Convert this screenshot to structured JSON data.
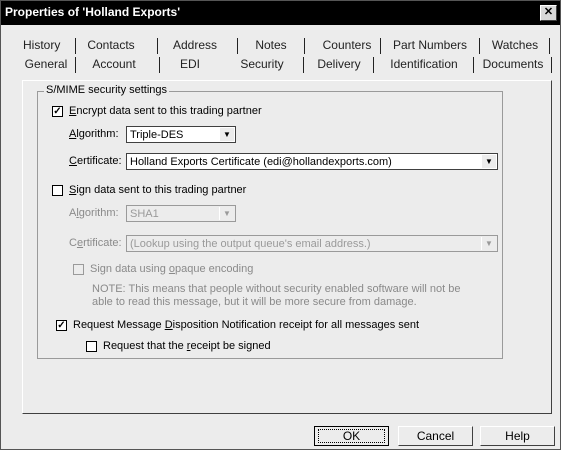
{
  "window": {
    "title": "Properties of 'Holland Exports'"
  },
  "tabs": {
    "row1": [
      "History",
      "Contacts",
      "Address",
      "Notes",
      "Counters",
      "Part Numbers",
      "Watches"
    ],
    "row2": [
      "General",
      "Account",
      "EDI",
      "Security",
      "Delivery",
      "Identification",
      "Documents"
    ],
    "selected": "Security"
  },
  "group": {
    "label": "S/MIME security settings"
  },
  "encrypt": {
    "checked": true,
    "label_pre": "",
    "label_acc": "E",
    "label_post": "ncrypt data sent to this trading partner",
    "algorithm_label_acc": "A",
    "algorithm_label_post": "lgorithm:",
    "algorithm_value": "Triple-DES",
    "certificate_label_acc": "C",
    "certificate_label_post": "ertificate:",
    "certificate_value": "Holland Exports Certificate (edi@hollandexports.com)"
  },
  "sign": {
    "checked": false,
    "label_acc": "S",
    "label_post": "ign data sent to this trading partner",
    "algorithm_label_acc": "l",
    "algorithm_label_pre": "A",
    "algorithm_label_post": "gorithm:",
    "algorithm_value": "SHA1",
    "certificate_label_pre": "C",
    "certificate_label_acc": "e",
    "certificate_label_post": "rtificate:",
    "certificate_value": "(Lookup using the output queue's email address.)",
    "opaque_label_pre": "Sign data using ",
    "opaque_label_acc": "o",
    "opaque_label_post": "paque encoding",
    "note": "NOTE: This means that people without security enabled software will not be able to read this message, but it will be more secure from damage."
  },
  "mdn": {
    "checked": true,
    "label_pre": "Request Message ",
    "label_acc": "D",
    "label_post": "isposition Notification receipt for all messages sent",
    "signed_label_pre": "Request that the ",
    "signed_label_acc": "r",
    "signed_label_post": "eceipt be signed",
    "signed_checked": false
  },
  "buttons": {
    "ok": "OK",
    "cancel": "Cancel",
    "help": "Help"
  }
}
